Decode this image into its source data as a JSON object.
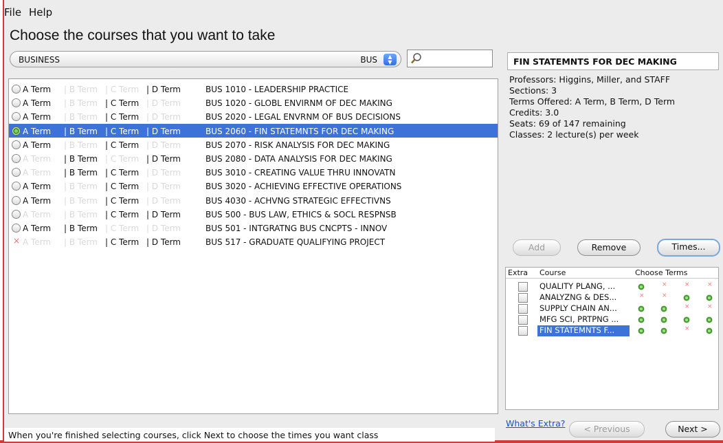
{
  "menu": {
    "file": "File",
    "help": "Help"
  },
  "page_title": "Choose the courses that you want to take",
  "department": {
    "name": "BUSINESS",
    "code": "BUS"
  },
  "search": {
    "value": ""
  },
  "courses": [
    {
      "state": "radio",
      "terms": [
        {
          "label": "A Term",
          "active": true
        },
        {
          "label": "B Term",
          "active": false
        },
        {
          "label": "C Term",
          "active": false
        },
        {
          "label": "D Term",
          "active": true
        }
      ],
      "title": "BUS 1010 - LEADERSHIP PRACTICE"
    },
    {
      "state": "radio",
      "terms": [
        {
          "label": "A Term",
          "active": true
        },
        {
          "label": "B Term",
          "active": false
        },
        {
          "label": "C Term",
          "active": true
        },
        {
          "label": "D Term",
          "active": false
        }
      ],
      "title": "BUS 1020 - GLOBL ENVIRNM OF DEC MAKING"
    },
    {
      "state": "radio",
      "terms": [
        {
          "label": "A Term",
          "active": true
        },
        {
          "label": "B Term",
          "active": false
        },
        {
          "label": "C Term",
          "active": true
        },
        {
          "label": "D Term",
          "active": false
        }
      ],
      "title": "BUS 2020 - LEGAL ENVRNM OF BUS DECISIONS"
    },
    {
      "state": "radio-on",
      "selected": true,
      "terms": [
        {
          "label": "A Term",
          "active": true
        },
        {
          "label": "B Term",
          "active": true
        },
        {
          "label": "C Term",
          "active": true
        },
        {
          "label": "D Term",
          "active": true
        }
      ],
      "title": "BUS 2060 - FIN STATEMNTS FOR DEC MAKING"
    },
    {
      "state": "radio",
      "terms": [
        {
          "label": "A Term",
          "active": true
        },
        {
          "label": "B Term",
          "active": false
        },
        {
          "label": "C Term",
          "active": true
        },
        {
          "label": "D Term",
          "active": false
        }
      ],
      "title": "BUS 2070 - RISK ANALYSIS FOR DEC MAKING"
    },
    {
      "state": "radio",
      "terms": [
        {
          "label": "A Term",
          "active": false
        },
        {
          "label": "B Term",
          "active": true
        },
        {
          "label": "C Term",
          "active": false
        },
        {
          "label": "D Term",
          "active": true
        }
      ],
      "title": "BUS 2080 - DATA ANALYSIS FOR DEC MAKING"
    },
    {
      "state": "radio",
      "terms": [
        {
          "label": "A Term",
          "active": false
        },
        {
          "label": "B Term",
          "active": true
        },
        {
          "label": "C Term",
          "active": true
        },
        {
          "label": "D Term",
          "active": false
        }
      ],
      "title": "BUS 3010 - CREATING VALUE THRU INNOVATN"
    },
    {
      "state": "radio",
      "terms": [
        {
          "label": "A Term",
          "active": true
        },
        {
          "label": "B Term",
          "active": false
        },
        {
          "label": "C Term",
          "active": true
        },
        {
          "label": "D Term",
          "active": false
        }
      ],
      "title": "BUS 3020 - ACHIEVING EFFECTIVE OPERATIONS"
    },
    {
      "state": "radio",
      "terms": [
        {
          "label": "A Term",
          "active": true
        },
        {
          "label": "B Term",
          "active": false
        },
        {
          "label": "C Term",
          "active": true
        },
        {
          "label": "D Term",
          "active": false
        }
      ],
      "title": "BUS 4030 - ACHVNG STRATEGIC EFFECTIVNS"
    },
    {
      "state": "radio",
      "terms": [
        {
          "label": "A Term",
          "active": false
        },
        {
          "label": "B Term",
          "active": false
        },
        {
          "label": "C Term",
          "active": true
        },
        {
          "label": "D Term",
          "active": true
        }
      ],
      "title": "BUS 500 - BUS LAW, ETHICS & SOCL RESPNSB"
    },
    {
      "state": "radio",
      "terms": [
        {
          "label": "A Term",
          "active": true
        },
        {
          "label": "B Term",
          "active": true
        },
        {
          "label": "C Term",
          "active": false
        },
        {
          "label": "D Term",
          "active": false
        }
      ],
      "title": "BUS 501 - INTGRATNG BUS CNCPTS - INNOV"
    },
    {
      "state": "x",
      "terms": [
        {
          "label": "A Term",
          "active": false
        },
        {
          "label": "B Term",
          "active": false
        },
        {
          "label": "C Term",
          "active": true
        },
        {
          "label": "D Term",
          "active": true
        }
      ],
      "title": "BUS 517 - GRADUATE QUALIFYING PROJECT"
    }
  ],
  "detail": {
    "title": "FIN STATEMNTS FOR DEC MAKING",
    "professors": "Professors: Higgins, Miller, and STAFF",
    "sections": "Sections: 3",
    "terms_offered": "Terms Offered: A Term, B Term, D Term",
    "credits": "Credits: 3.0",
    "seats": "Seats: 69 of 147 remaining",
    "classes": "Classes: 2 lecture(s) per week"
  },
  "buttons": {
    "add": "Add",
    "remove": "Remove",
    "times": "Times...",
    "previous": "< Previous",
    "next": "Next >"
  },
  "chosen": {
    "headers": {
      "extra": "Extra",
      "course": "Course",
      "choose_terms": "Choose Terms"
    },
    "rows": [
      {
        "title": "QUALITY PLANG, ...",
        "terms": [
          true,
          false,
          false,
          false
        ]
      },
      {
        "title": "ANALYZNG & DES...",
        "terms": [
          false,
          false,
          true,
          true
        ]
      },
      {
        "title": "SUPPLY CHAIN AN...",
        "terms": [
          true,
          true,
          false,
          false
        ]
      },
      {
        "title": "MFG SCI, PRTPNG ...",
        "terms": [
          true,
          true,
          true,
          true
        ]
      },
      {
        "title": "FIN STATEMNTS F...",
        "terms": [
          true,
          true,
          false,
          true
        ],
        "selected": true
      }
    ]
  },
  "whats_extra": "What's Extra?",
  "status_text": "When you're finished selecting courses, click Next to choose the times you want class"
}
